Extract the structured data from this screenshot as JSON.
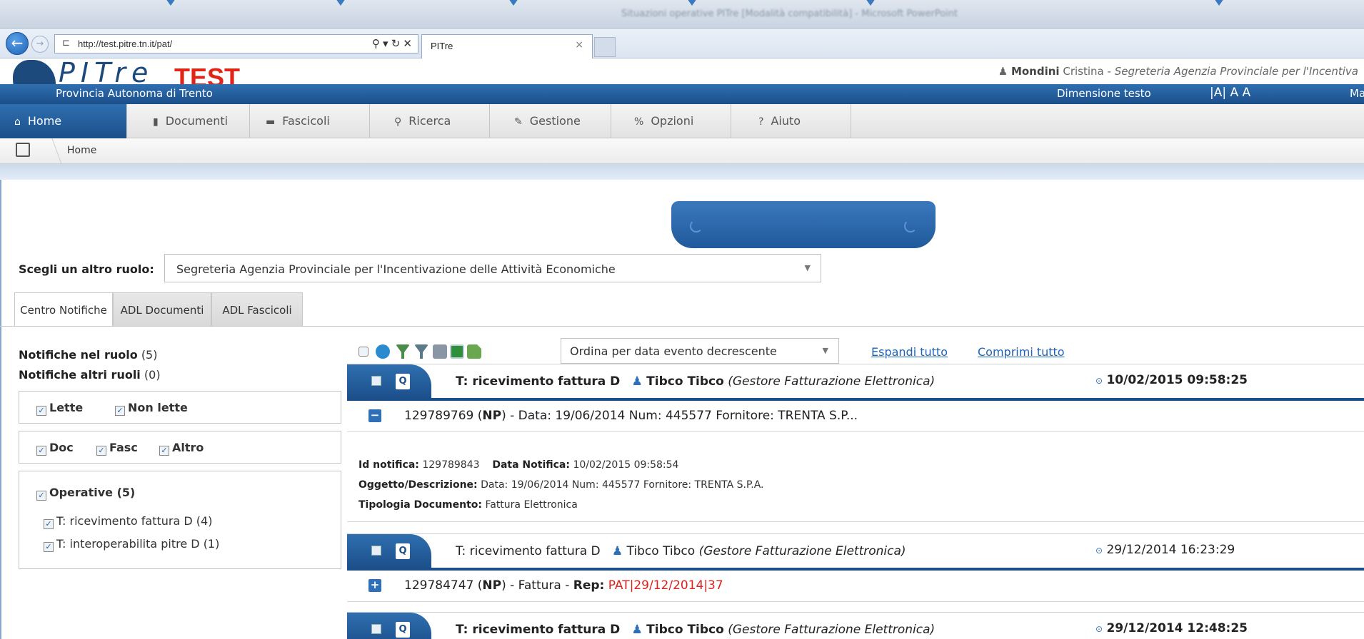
{
  "browser": {
    "url": "http://test.pitre.tn.it/pat/",
    "tab_title": "PITre",
    "tab_close": "×",
    "addr_tools": "⚲ ▾ ↻ ✕",
    "window_title": "Situazioni operative PITre [Modalità compatibilità] - Microsoft PowerPoint"
  },
  "header": {
    "logo_text": "PITre",
    "logo_badge": "TEST",
    "user_first_bold": "Mondini",
    "user_rest": "Cristina",
    "user_role": "Segreteria Agenzia Provinciale per l'Incentiva",
    "province": "Provincia Autonoma di Trento",
    "text_size_label": "Dimensione testo",
    "text_size_options": "|A| A A",
    "right_cut": "Ma"
  },
  "menu": [
    {
      "label": "Home",
      "icon": "home-icon",
      "glyph": "⌂"
    },
    {
      "label": "Documenti",
      "icon": "document-icon",
      "glyph": "▮"
    },
    {
      "label": "Fascicoli",
      "icon": "folder-icon",
      "glyph": "▬"
    },
    {
      "label": "Ricerca",
      "icon": "search-icon",
      "glyph": "⚲"
    },
    {
      "label": "Gestione",
      "icon": "pencil-icon",
      "glyph": "✎"
    },
    {
      "label": "Opzioni",
      "icon": "options-icon",
      "glyph": "%"
    },
    {
      "label": "Aiuto",
      "icon": "help-icon",
      "glyph": "?"
    }
  ],
  "breadcrumb": {
    "label": "Home"
  },
  "role": {
    "label": "Scegli un altro ruolo:",
    "value": "Segreteria Agenzia Provinciale per l'Incentivazione delle Attività Economiche"
  },
  "tabs": [
    "Centro Notifiche",
    "ADL Documenti",
    "ADL Fascicoli"
  ],
  "left": {
    "nel_ruolo_label": "Notifiche nel ruolo",
    "nel_ruolo_count": "(5)",
    "altri_ruoli_label": "Notifiche altri ruoli",
    "altri_ruoli_count": "(0)",
    "lette": "Lette",
    "non_lette": "Non lette",
    "doc": "Doc",
    "fasc": "Fasc",
    "altro": "Altro",
    "operative": "Operative (5)",
    "op1": "T: ricevimento fattura D (4)",
    "op2": "T: interoperabilita pitre D (1)"
  },
  "toolbar": {
    "sort_value": "Ordina per data evento decrescente",
    "expand_all": "Espandi tutto",
    "collapse_all": "Comprimi tutto"
  },
  "notifications": [
    {
      "title": "T: ricevimento fattura D",
      "person": "Tibco Tibco",
      "person_role": "(Gestore Fatturazione Elettronica)",
      "date": "10/02/2015 09:58:25",
      "doc_id": "129789769",
      "doc_type": "NP",
      "summary": "- Data: 19/06/2014 Num: 445577 Fornitore: TRENTA S.P...",
      "id_label": "Id notifica:",
      "id_value": "129789843",
      "date_label": "Data Notifica:",
      "date_value": "10/02/2015 09:58:54",
      "obj_label": "Oggetto/Descrizione:",
      "obj_value": "Data: 19/06/2014 Num: 445577 Fornitore: TRENTA S.P.A.",
      "type_label": "Tipologia Documento:",
      "type_value": "Fattura Elettronica"
    },
    {
      "title": "T: ricevimento fattura D",
      "person": "Tibco Tibco",
      "person_role": "(Gestore Fatturazione Elettronica)",
      "date": "29/12/2014 16:23:29",
      "doc_id": "129784747",
      "doc_type": "NP",
      "summary": "- Fattura -",
      "rep_label": "Rep:",
      "rep_value": "PAT|29/12/2014|37"
    },
    {
      "title": "T: ricevimento fattura D",
      "person": "Tibco Tibco",
      "person_role": "(Gestore Fatturazione Elettronica)",
      "date": "29/12/2014 12:48:25"
    }
  ],
  "colors": {
    "brand_blue": "#1c4f8a",
    "accent_red": "#e0201a",
    "link_blue": "#1f63b8"
  }
}
